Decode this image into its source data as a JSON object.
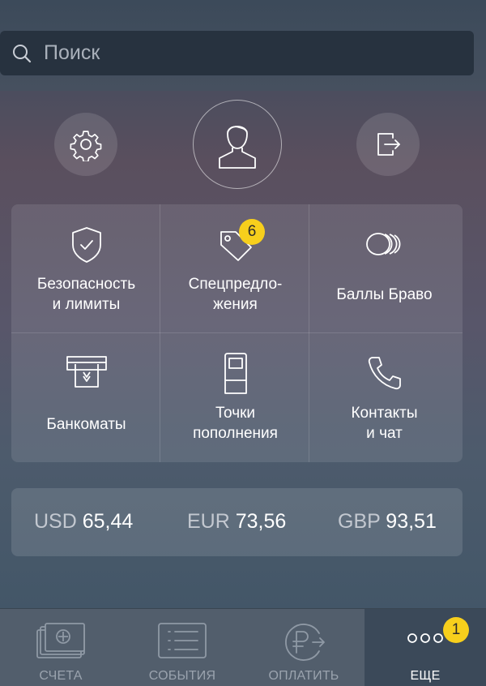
{
  "search": {
    "placeholder": "Поиск"
  },
  "header": {
    "settings_icon": "gear-icon",
    "profile_icon": "user-icon",
    "logout_icon": "logout-icon"
  },
  "menu": {
    "items": [
      {
        "label": "Безопасность\nи лимиты",
        "icon": "shield-check-icon"
      },
      {
        "label": "Спецпредло-\nжения",
        "icon": "price-tag-icon",
        "badge": "6"
      },
      {
        "label": "Баллы Браво",
        "icon": "coins-icon"
      },
      {
        "label": "Банкоматы",
        "icon": "atm-icon"
      },
      {
        "label": "Точки\nпополнения",
        "icon": "terminal-icon"
      },
      {
        "label": "Контакты\nи чат",
        "icon": "phone-icon"
      }
    ]
  },
  "rates": [
    {
      "code": "USD",
      "value": "65,44"
    },
    {
      "code": "EUR",
      "value": "73,56"
    },
    {
      "code": "GBP",
      "value": "93,51"
    }
  ],
  "tabbar": {
    "tabs": [
      {
        "label": "СЧЕТА",
        "icon": "accounts-icon"
      },
      {
        "label": "СОБЫТИЯ",
        "icon": "events-list-icon"
      },
      {
        "label": "ОПЛАТИТЬ",
        "icon": "ruble-pay-icon"
      },
      {
        "label": "ЕЩЕ",
        "icon": "more-icon",
        "badge": "1",
        "active": true
      }
    ]
  },
  "colors": {
    "badge": "#f7cf1c",
    "search_bg": "#27323f",
    "active_tab": "#3b4959"
  }
}
